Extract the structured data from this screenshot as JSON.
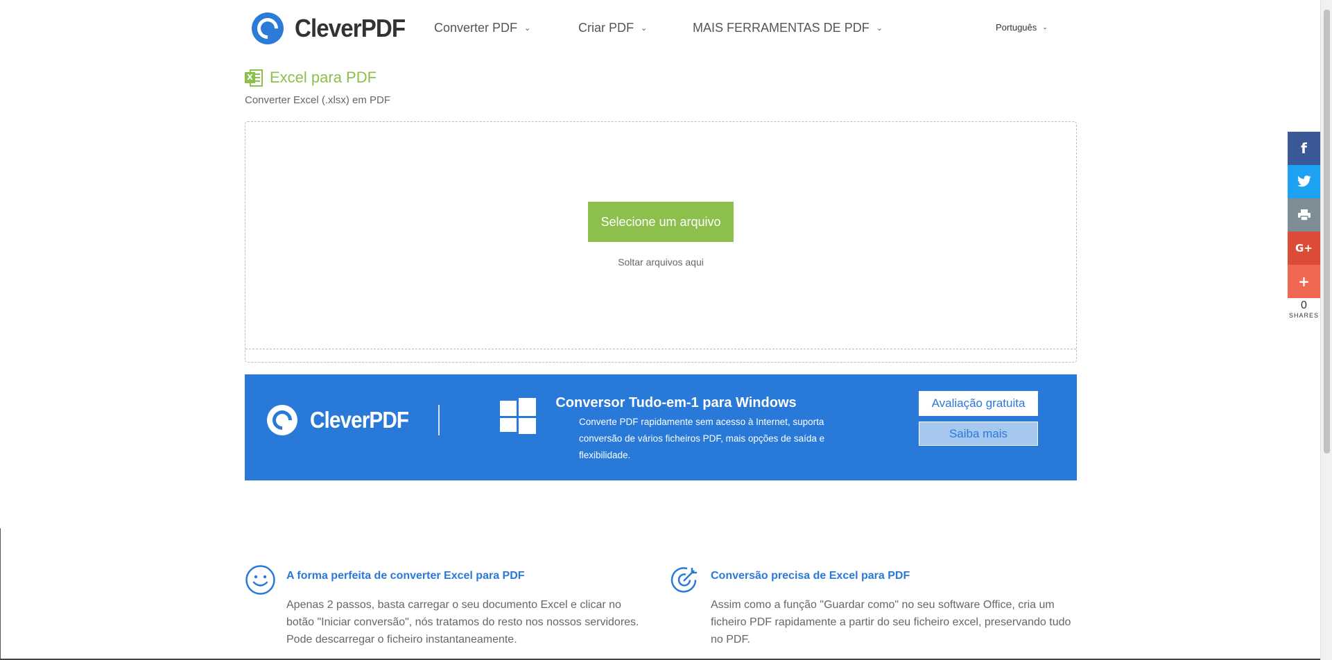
{
  "header": {
    "brand": "CleverPDF",
    "nav": [
      {
        "label": "Converter PDF"
      },
      {
        "label": "Criar PDF"
      },
      {
        "label": "MAIS FERRAMENTAS DE PDF"
      }
    ],
    "language": "Português"
  },
  "main": {
    "title": "Excel para PDF",
    "subtitle": "Converter Excel (.xlsx) em PDF",
    "select_button": "Selecione um arquivo",
    "drop_hint": "Soltar arquivos aqui"
  },
  "banner": {
    "brand": "CleverPDF",
    "title": "Conversor Tudo-em-1 para Windows",
    "description": "Converte PDF rapidamente sem acesso à Internet, suporta conversão de vários ficheiros PDF, mais opções de saída e flexibilidade.",
    "trial_button": "Avaliação gratuita",
    "more_button": "Saiba mais"
  },
  "features": [
    {
      "icon": "smiley-icon",
      "title": "A forma perfeita de converter Excel para PDF",
      "text": "Apenas 2 passos, basta carregar o seu documento Excel e clicar no botão \"Iniciar conversão\", nós tratamos do resto nos nossos servidores. Pode descarregar o ficheiro instantaneamente."
    },
    {
      "icon": "target-icon",
      "title": "Conversão precisa de Excel para PDF",
      "text": "Assim como a função \"Guardar como\" no seu software Office, cria um ficheiro PDF rapidamente a partir do seu ficheiro excel, preservando tudo no PDF."
    }
  ],
  "share": {
    "count": "0",
    "label": "SHARES",
    "colors": {
      "facebook": "#3b5998",
      "twitter": "#1da1f2",
      "print": "#7d8d95",
      "googleplus": "#dc4a38",
      "more": "#f26752"
    }
  },
  "colors": {
    "brand_blue": "#2979d9",
    "excel_green": "#8cbf4b"
  }
}
